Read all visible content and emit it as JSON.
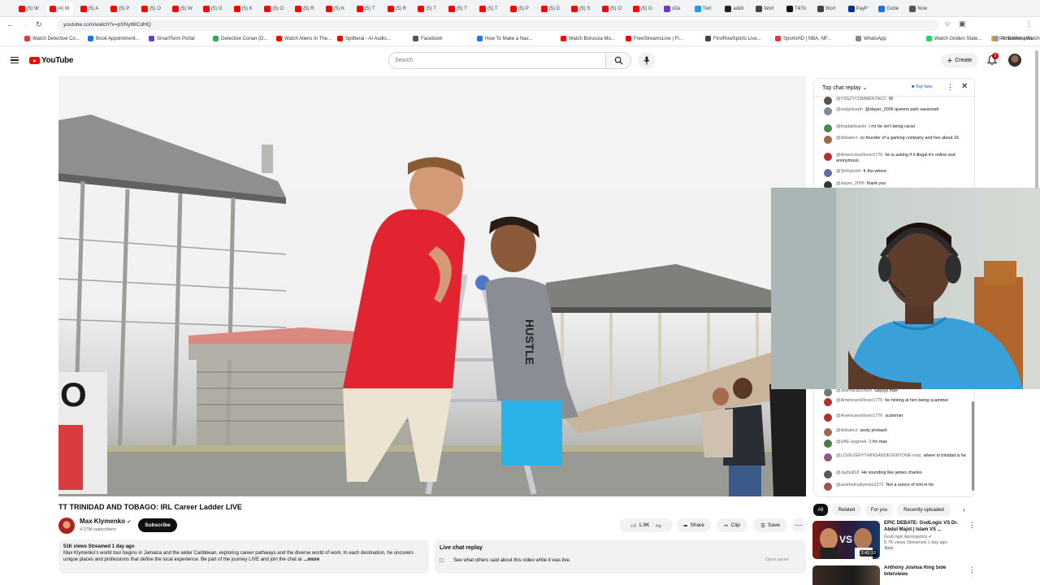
{
  "browser": {
    "tabs": [
      "(5) W",
      "(4) W",
      "(5) A",
      "(5) P",
      "(5) O",
      "(5) W",
      "(5) O",
      "(5) K",
      "(5) O",
      "(5) R",
      "(5) K",
      "(5) T",
      "(5) R",
      "(5) T",
      "(5) T",
      "(5) T",
      "(5) P",
      "(5) D",
      "(5) S",
      "(5) O",
      "(5) O",
      "sDe",
      "Twit",
      "adidi",
      "Worl",
      "TikTo",
      "Worl",
      "PayP",
      "Gobe",
      "Now"
    ],
    "url": "youtube.com/watch?v=pSNyt6tCdHQ",
    "bookmarks": [
      "Watch Detective Co...",
      "Book Appointment...",
      "SmartTerm Portal",
      "Detective Conan (D...",
      "Watch Aliens In The...",
      "Splitterai - AI Audio...",
      "Facebook",
      "How To Make a Nav...",
      "Watch Borussia Mo...",
      "FreeStreamsLive | Fr...",
      "FirstRowSports Live...",
      "SportsHD | NBA, NF...",
      "WhatsApp",
      "Watch Golden State...",
      "PrimeWire | Watch..."
    ],
    "all_bookmarks": "All Bookmarks"
  },
  "header": {
    "logo": "YouTube",
    "search_placeholder": "Search",
    "create_label": "Create",
    "notification_count": "9"
  },
  "video": {
    "title": "TT TRINIDAD AND TOBAGO: IRL Career Ladder LIVE",
    "sign_letter": "O",
    "scene_text": "HUSTLE"
  },
  "channel": {
    "name": "Max Klymenko",
    "subscribers": "4.07M subscribers",
    "subscribe_label": "Subscribe"
  },
  "actions": {
    "likes": "1.9K",
    "share": "Share",
    "clip": "Clip",
    "save": "Save"
  },
  "description": {
    "meta": "51K views  Streamed 1 day ago",
    "text": "Max Klymenko's world tour begins in Jamaica and the wider Caribbean, exploring career pathways and the diverse world of work. In each destination, he uncovers unique places and professions that define the local experience. Be part of the journey LIVE and join the chat ar",
    "more": "...more"
  },
  "live_chat_replay": {
    "title": "Live chat replay",
    "subtitle": "See what others said about this video while it was live.",
    "open_panel": "Open panel"
  },
  "chat": {
    "title": "Top chat replay",
    "top_fans": "Top fans",
    "messages_top": [
      {
        "author": "@YSSZYCOMMENTACC",
        "text": "W",
        "color": "#555555"
      },
      {
        "author": "@realjeliseph",
        "text": "@slayer_2006 queens park savannah",
        "color": "#7a8a9a"
      },
      {
        "author": "@thadainbaishi",
        "text": "I mr he isn't being racist",
        "color": "#4a8a4a"
      },
      {
        "author": "@iitsbalect",
        "text": "co founder of a gaming company and hes about 16",
        "color": "#9a6a4a"
      },
      {
        "author": "@Americanoillover1776",
        "text": "he is asking if it illegal it's online and anonymous",
        "color": "#b03030"
      },
      {
        "author": "@Sirthyboihi",
        "text": "fr tho where",
        "color": "#6a6aa0"
      },
      {
        "author": "@slayer_2006",
        "text": "thank you",
        "color": "#333333"
      }
    ],
    "messages_bottom": [
      {
        "author": "@JournaIIaccount",
        "text": "Sayyyy max",
        "color": "#777777"
      },
      {
        "author": "@Americanoillover1776",
        "text": "he hinting at him being scammer",
        "color": "#b03030"
      },
      {
        "author": "@Americanoillover1776",
        "text": "scammer",
        "color": "#b03030"
      },
      {
        "author": "@iitsbalect",
        "text": "zesty prokash",
        "color": "#9a6a4a"
      },
      {
        "author": "@UAE-aygreek",
        "text": "1 for max",
        "color": "#4a7a4a"
      },
      {
        "author": "@LOVEVERYTHINGANDEVERYONE-msq",
        "text": "where in trinidad is he",
        "color": "#8a5a8a"
      },
      {
        "author": "@Jaybull18",
        "text": "He sounding like james charles",
        "color": "#5a5a5a"
      },
      {
        "author": "@aestheticallymiso2272",
        "text": "Not a ounce of trini in he",
        "color": "#a05050"
      }
    ]
  },
  "sidebar": {
    "chips": [
      "All",
      "Related",
      "For you",
      "Recently uploaded"
    ],
    "recommendations": [
      {
        "title": "EPIC DEBATE: GodLogic VS Dr. Abdul Majid | Islam VS ...",
        "channel": "GodLogic Apologetics",
        "meta": "5.7K views  Streamed 1 day ago",
        "badge": "New",
        "duration": "2:42:10",
        "vs": "VS"
      },
      {
        "title": "Anthony Joshua Ring Side Interviews",
        "channel": "",
        "meta": "",
        "badge": "",
        "duration": "",
        "vs": ""
      }
    ]
  },
  "colors": {
    "accent_red": "#ff0000",
    "subscribe_bg": "#0f0f0f",
    "chip_bg": "#f2f2f2"
  }
}
